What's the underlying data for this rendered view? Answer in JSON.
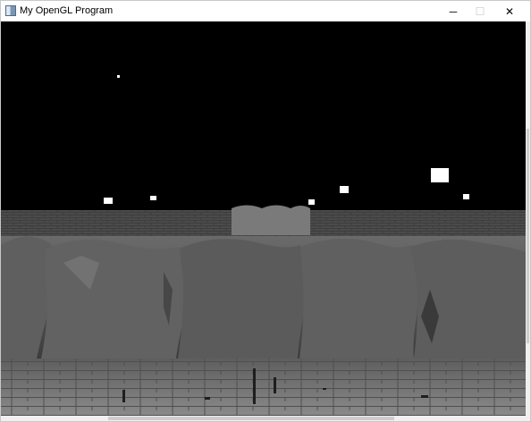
{
  "window": {
    "title": "My OpenGL Program",
    "icon": "app-window-icon",
    "controls": {
      "minimize": "─",
      "maximize": "☐",
      "close": "✕"
    }
  },
  "scene": {
    "sky_color": "#000000",
    "wall_color": "#4a4a4a",
    "terrain_color": "#5a5a5a",
    "floor_color": "#6f6f6f"
  }
}
